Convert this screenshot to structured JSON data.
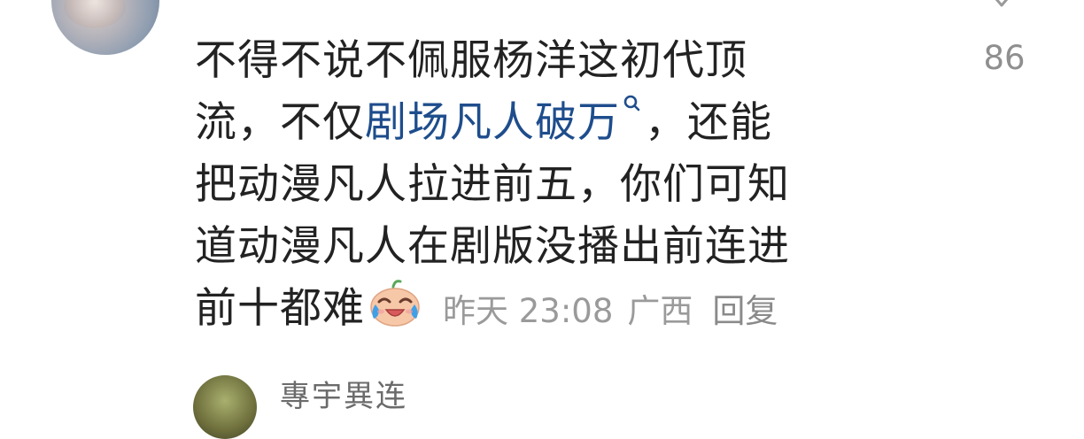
{
  "comment": {
    "like_count": "86",
    "lines": [
      "不得不说不佩服杨洋这初代顶",
      "流，不仅",
      "，还能",
      "把动漫凡人拉进前五，你们可知",
      "道动漫凡人在剧版没播出前连进",
      "前十都难"
    ],
    "topic_link": "剧场凡人破万",
    "emoji_name": "crying-laughing-face-emoji",
    "time": "昨天 23:08",
    "location": "广西",
    "reply_label": "回复"
  },
  "next_comment": {
    "username": "專宇異连"
  },
  "colors": {
    "link": "#1e4d8c",
    "meta": "#9a9a9a",
    "text": "#222222"
  },
  "icons": {
    "like": "heart-outline-icon",
    "topic": "search-icon"
  }
}
